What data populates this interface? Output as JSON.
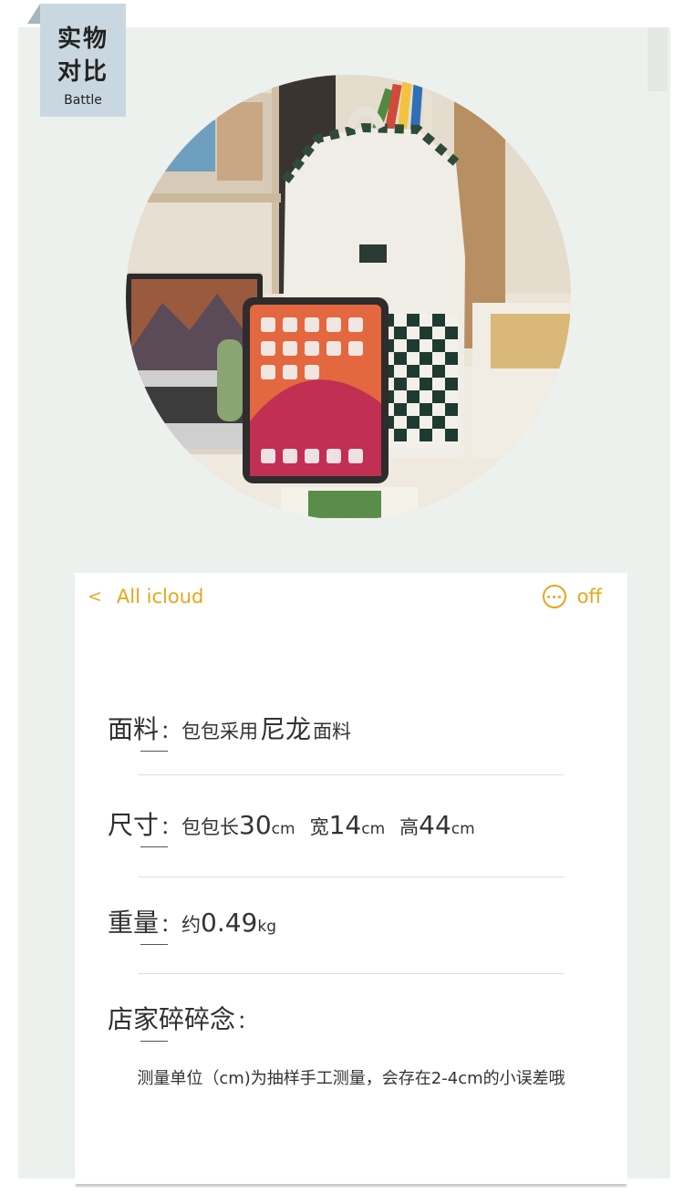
{
  "tag": {
    "line1": "实物",
    "line2": "对比",
    "sub": "Battle"
  },
  "card": {
    "nav": {
      "back_label": "All icloud",
      "right_label": "off"
    },
    "rows": {
      "fabric": {
        "label": "面料",
        "colon": "：",
        "value_pre": "包包采用",
        "value_big": "尼龙",
        "value_post": "面料"
      },
      "size": {
        "label": "尺寸",
        "colon": "：",
        "length_pre": "包包长",
        "length_num": "30",
        "length_unit": "cm",
        "width_pre": "宽",
        "width_num": "14",
        "width_unit": "cm",
        "height_pre": "高",
        "height_num": "44",
        "height_unit": "cm"
      },
      "weight": {
        "label": "重量",
        "colon": "：",
        "value_pre": "约",
        "value_num": "0.49",
        "value_unit": "kg"
      },
      "notes": {
        "label": "店家碎碎念",
        "colon": "："
      }
    },
    "note_text": "测量单位（cm)为抽样手工测量，会存在2-4cm的小误差哦"
  },
  "colors": {
    "accent": "#e9a51b",
    "panel": "#edf1ee",
    "tag": "#c9d8e0",
    "text": "#2f2f2f"
  }
}
